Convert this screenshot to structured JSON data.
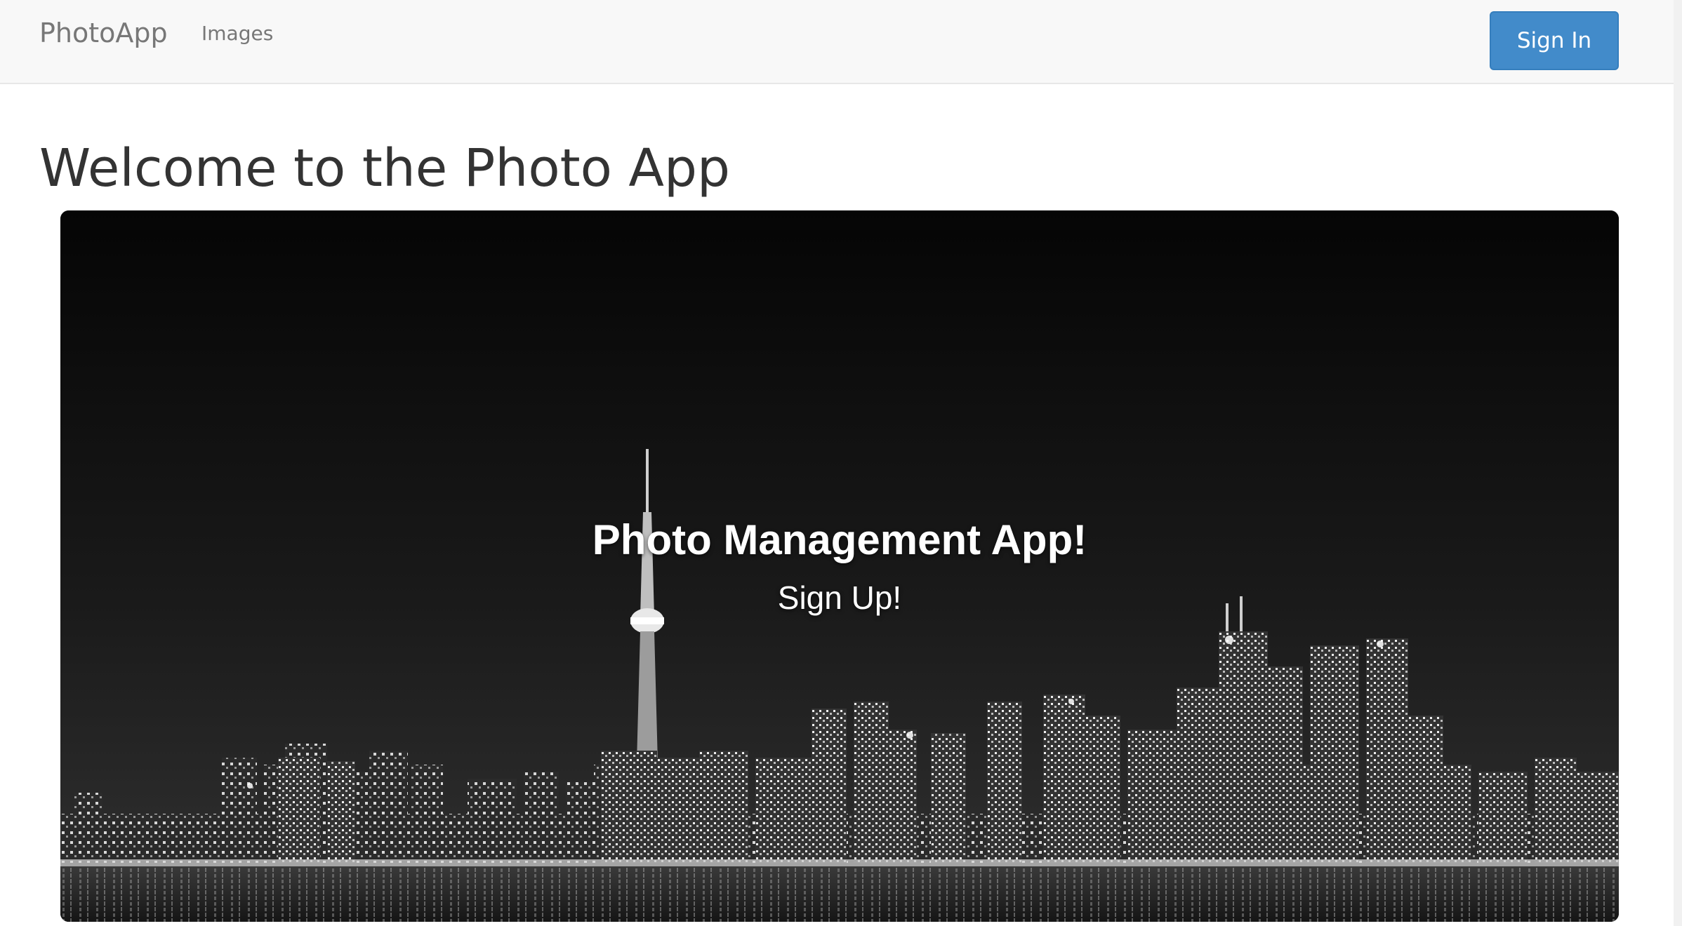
{
  "navbar": {
    "brand": "PhotoApp",
    "links": [
      {
        "label": "Images"
      }
    ],
    "sign_in_label": "Sign In"
  },
  "main": {
    "title": "Welcome to the Photo App",
    "hero": {
      "heading": "Photo Management App!",
      "signup_label": "Sign Up!"
    }
  },
  "colors": {
    "navbar_bg": "#f8f8f8",
    "primary_button": "#428bca",
    "hero_bg": "#0a0a0a",
    "text_dark": "#333333",
    "nav_text": "#777777"
  }
}
